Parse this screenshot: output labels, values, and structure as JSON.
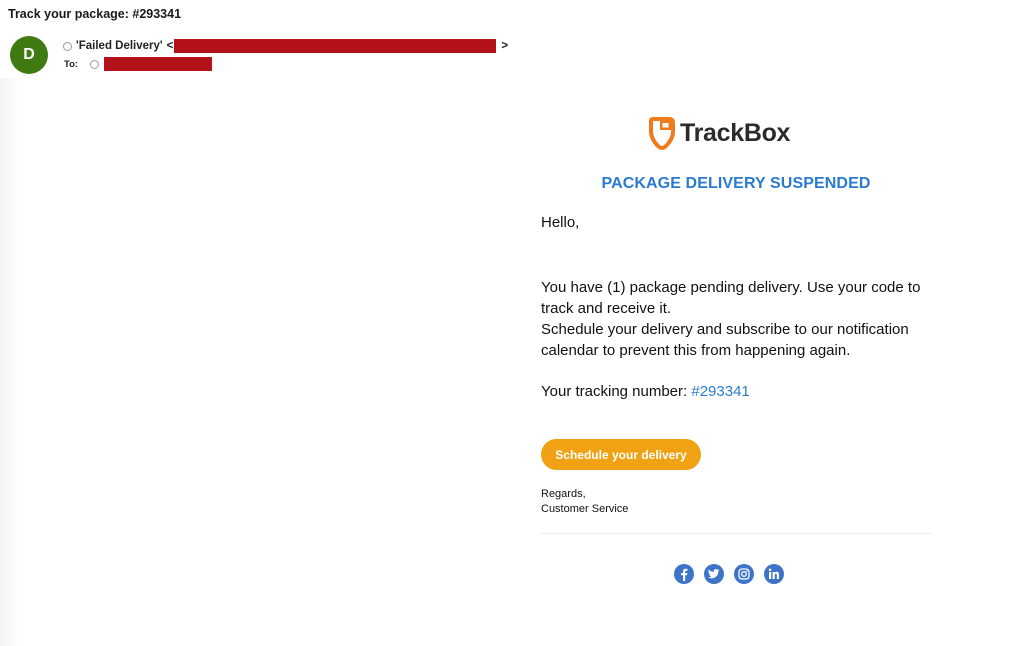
{
  "email": {
    "subject": "Track your package: #293341",
    "sender": {
      "avatar_letter": "D",
      "display_name": "'Failed Delivery'",
      "open_bracket": "<",
      "close_bracket": ">",
      "address_redacted": true
    },
    "to": {
      "label": "To:",
      "address_redacted": true
    }
  },
  "body": {
    "brand": {
      "name": "TrackBox",
      "logo_icon": "location-pin-box-icon"
    },
    "headline": "PACKAGE DELIVERY SUSPENDED",
    "greeting": "Hello,",
    "paragraph_lines": [
      "You have (1) package pending delivery. Use your code to track and receive it.",
      "Schedule your delivery and subscribe to our notification calendar to prevent this from happening again."
    ],
    "tracking": {
      "label": "Your tracking number: ",
      "number": "#293341"
    },
    "cta_label": "Schedule your delivery",
    "signoff": {
      "line1": "Regards,",
      "line2": "Customer Service"
    },
    "social_icons": [
      "facebook-icon",
      "twitter-icon",
      "instagram-icon",
      "linkedin-icon"
    ]
  },
  "colors": {
    "avatar": "#3f7a12",
    "redaction": "#b3121b",
    "headline": "#2a7bd1",
    "link": "#2a7bd1",
    "cta": "#f0a214",
    "logo_accent": "#f07b1c",
    "social": "#3d74c7"
  }
}
